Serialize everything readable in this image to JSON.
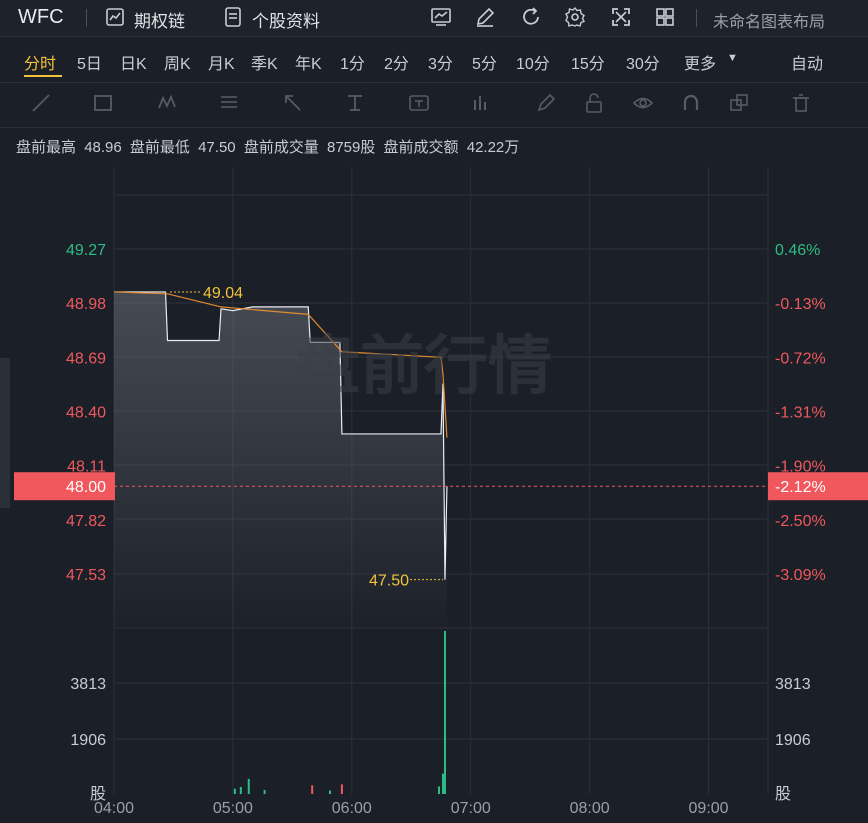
{
  "header": {
    "ticker": "WFC",
    "links": [
      {
        "label": "期权链",
        "icon": "chart-box-icon"
      },
      {
        "label": "个股资料",
        "icon": "document-icon"
      }
    ],
    "tools": [
      "chart-compare-icon",
      "pencil-icon",
      "refresh-icon",
      "gear-icon",
      "fullscreen-icon",
      "grid-icon"
    ],
    "layout_label": "未命名图表布局"
  },
  "periods": {
    "tabs": [
      "分时",
      "5日",
      "日K",
      "周K",
      "月K",
      "季K",
      "年K",
      "1分",
      "2分",
      "3分",
      "5分",
      "10分",
      "15分",
      "30分",
      "更多"
    ],
    "active": "分时",
    "right_label": "自动"
  },
  "draw_tools": [
    "line-tool-icon",
    "rect-tool-icon",
    "wave-tool-icon",
    "fib-tool-icon",
    "arrow-tool-icon",
    "measure-tool-icon",
    "text-tool-icon",
    "bar-tool-icon",
    "brush-icon",
    "lock-icon",
    "eye-icon",
    "magnet-icon",
    "layers-icon",
    "trash-icon"
  ],
  "info": {
    "items": [
      {
        "label": "盘前最高",
        "value": "48.96"
      },
      {
        "label": "盘前最低",
        "value": "47.50"
      },
      {
        "label": "盘前成交量",
        "value": "8759股"
      },
      {
        "label": "盘前成交额",
        "value": "42.22万"
      }
    ]
  },
  "watermark": "盘前行情",
  "colors": {
    "background": "#1b1f27",
    "up": "#2ebd85",
    "down": "#f0585e",
    "price_line": "#e08a30",
    "avg_line": "#c8ccd4",
    "highlight": "#f2c23a"
  },
  "chart_data": {
    "type": "line",
    "x_ticks": [
      "04:00",
      "05:00",
      "06:00",
      "07:00",
      "08:00",
      "09:00"
    ],
    "y_ticks": [
      "49.27",
      "48.98",
      "48.69",
      "48.40",
      "48.11",
      "47.82",
      "47.53"
    ],
    "pct_ticks": [
      "0.46%",
      "-0.13%",
      "-0.72%",
      "-1.31%",
      "-1.90%",
      "-2.50%",
      "-3.09%"
    ],
    "ylim": [
      47.39,
      49.41
    ],
    "current_price": "48.00",
    "current_pct": "-2.12%",
    "high_label": "49.04",
    "low_label": "47.50",
    "price_series": [
      {
        "t": "04:00",
        "v": 49.04
      },
      {
        "t": "04:26",
        "v": 49.04
      },
      {
        "t": "04:27",
        "v": 48.78
      },
      {
        "t": "04:53",
        "v": 48.78
      },
      {
        "t": "04:54",
        "v": 48.95
      },
      {
        "t": "05:00",
        "v": 48.94
      },
      {
        "t": "05:10",
        "v": 48.96
      },
      {
        "t": "05:38",
        "v": 48.96
      },
      {
        "t": "05:39",
        "v": 48.77
      },
      {
        "t": "05:54",
        "v": 48.77
      },
      {
        "t": "05:55",
        "v": 48.28
      },
      {
        "t": "06:45",
        "v": 48.28
      },
      {
        "t": "06:46",
        "v": 48.55
      },
      {
        "t": "06:47",
        "v": 47.5
      },
      {
        "t": "06:48",
        "v": 48.0
      }
    ],
    "avg_series": [
      {
        "t": "04:00",
        "v": 49.04
      },
      {
        "t": "04:27",
        "v": 49.03
      },
      {
        "t": "04:54",
        "v": 48.96
      },
      {
        "t": "05:38",
        "v": 48.92
      },
      {
        "t": "05:55",
        "v": 48.72
      },
      {
        "t": "06:45",
        "v": 48.69
      },
      {
        "t": "06:46",
        "v": 48.6
      },
      {
        "t": "06:48",
        "v": 48.26
      }
    ],
    "volume_ticks": [
      "3813",
      "1906"
    ],
    "volume_unit": "股",
    "volume_max": 5719,
    "volume_bars": [
      {
        "t": "05:01",
        "v": 180,
        "dir": "up"
      },
      {
        "t": "05:04",
        "v": 240,
        "dir": "up"
      },
      {
        "t": "05:08",
        "v": 520,
        "dir": "up"
      },
      {
        "t": "05:16",
        "v": 140,
        "dir": "up"
      },
      {
        "t": "05:40",
        "v": 300,
        "dir": "down"
      },
      {
        "t": "05:49",
        "v": 120,
        "dir": "up"
      },
      {
        "t": "05:55",
        "v": 330,
        "dir": "down"
      },
      {
        "t": "06:44",
        "v": 260,
        "dir": "up"
      },
      {
        "t": "06:46",
        "v": 700,
        "dir": "up"
      },
      {
        "t": "06:47",
        "v": 5600,
        "dir": "up"
      }
    ]
  }
}
